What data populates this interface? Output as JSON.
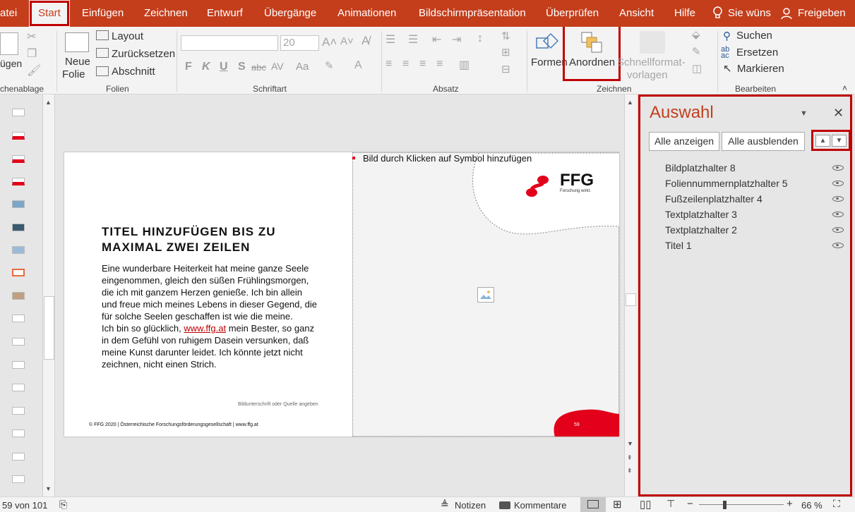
{
  "tabs": [
    "atei",
    "Start",
    "Einfügen",
    "Zeichnen",
    "Entwurf",
    "Übergänge",
    "Animationen",
    "Bildschirmpräsentation",
    "Überprüfen",
    "Ansicht",
    "Hilfe"
  ],
  "tell_me": "Sie wünsc",
  "share": "Freigeben",
  "ribbon": {
    "paste": "ügen",
    "clipboard_group": "chenablage",
    "new_slide_1": "Neue",
    "new_slide_2": "Folie",
    "layout": "Layout",
    "reset": "Zurücksetzen",
    "section": "Abschnitt",
    "slides_group": "Folien",
    "font_size": "20",
    "font_group": "Schriftart",
    "paragraph_group": "Absatz",
    "shapes": "Formen",
    "arrange": "Anordnen",
    "quick_styles_1": "Schnellformat-",
    "quick_styles_2": "vorlagen",
    "drawing_group": "Zeichnen",
    "find": "Suchen",
    "replace": "Ersetzen",
    "select": "Markieren",
    "editing_group": "Bearbeiten",
    "format_buttons": [
      "F",
      "K",
      "U",
      "S",
      "abc",
      "AV",
      "Aa"
    ]
  },
  "slide": {
    "placeholder_hint": "Bild durch Klicken auf Symbol hinzufügen",
    "logo_text": "FFG",
    "logo_sub": "Forschung wirkt.",
    "title_line1": "TITEL HINZUFÜGEN BIS ZU",
    "title_line2": "MAXIMAL ZWEI ZEILEN",
    "body_lines": [
      "Eine wunderbare Heiterkeit hat meine ganze Seele",
      "eingenommen, gleich den süßen Frühlingsmorgen,",
      "die ich mit ganzem Herzen genieße. Ich bin allein",
      "und freue mich meines Lebens in dieser Gegend, die",
      "für solche Seelen geschaffen ist wie die meine."
    ],
    "body_line6_pre": "Ich bin so glücklich, ",
    "body_link": "www.ffg.at",
    "body_line6_post": " mein Bester, so ganz",
    "body_line7": "in dem Gefühl von ruhigem Dasein versunken, daß",
    "body_line8": "meine Kunst darunter leidet. Ich könnte jetzt nicht",
    "body_line9": "zeichnen, nicht einen Strich.",
    "caption": "Bildunterschrift oder Quelle angeben",
    "footer": "© FFG 2020 | Österreichische Forschungsförderungsgesellschaft | www.ffg.at",
    "page_number": "59"
  },
  "pane": {
    "title": "Auswahl",
    "show_all": "Alle anzeigen",
    "hide_all": "Alle ausblenden",
    "items": [
      "Bildplatzhalter 8",
      "Foliennummernplatzhalter 5",
      "Fußzeilenplatzhalter 4",
      "Textplatzhalter 3",
      "Textplatzhalter 2",
      "Titel 1"
    ]
  },
  "status": {
    "slide_count": "59 von 101",
    "notes": "Notizen",
    "comments": "Kommentare",
    "zoom": "66 %"
  },
  "colors": {
    "accent": "#c43e1c",
    "highlight": "#c00000",
    "ffg_red": "#e2001a"
  }
}
